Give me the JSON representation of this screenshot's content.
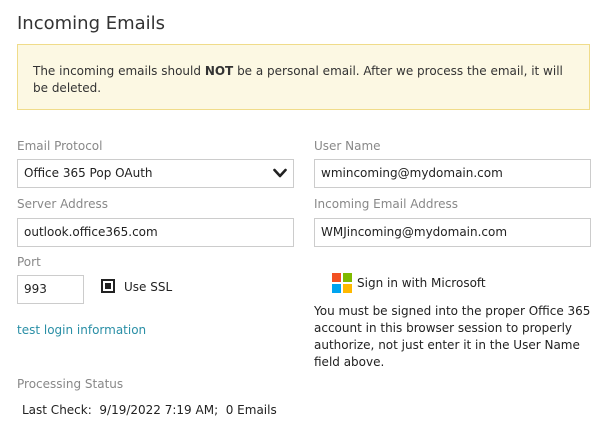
{
  "title": "Incoming Emails",
  "alert": {
    "prefix": "The incoming emails should ",
    "bold": "NOT",
    "suffix": " be a personal email. After we process the email, it will be deleted."
  },
  "form": {
    "protocol_label": "Email Protocol",
    "protocol_value": "Office 365 Pop OAuth",
    "server_label": "Server Address",
    "server_value": "outlook.office365.com",
    "port_label": "Port",
    "port_value": "993",
    "ssl_label": "Use SSL",
    "ssl_checked": true,
    "username_label": "User Name",
    "username_value": "wmincoming@mydomain.com",
    "incoming_label": "Incoming Email Address",
    "incoming_value": "WMJincoming@mydomain.com"
  },
  "test_link": "test login information",
  "microsoft": {
    "button_label": "Sign in with Microsoft",
    "logo_colors": [
      "#f25022",
      "#7fba00",
      "#00a4ef",
      "#ffb900"
    ],
    "note": "You must be signed into the proper Office 365 account in this browser session to properly authorize, not just enter it in the User Name field above."
  },
  "status": {
    "label": "Processing Status",
    "last_check": "Last Check:  9/19/2022 7:19 AM;  0 Emails"
  }
}
